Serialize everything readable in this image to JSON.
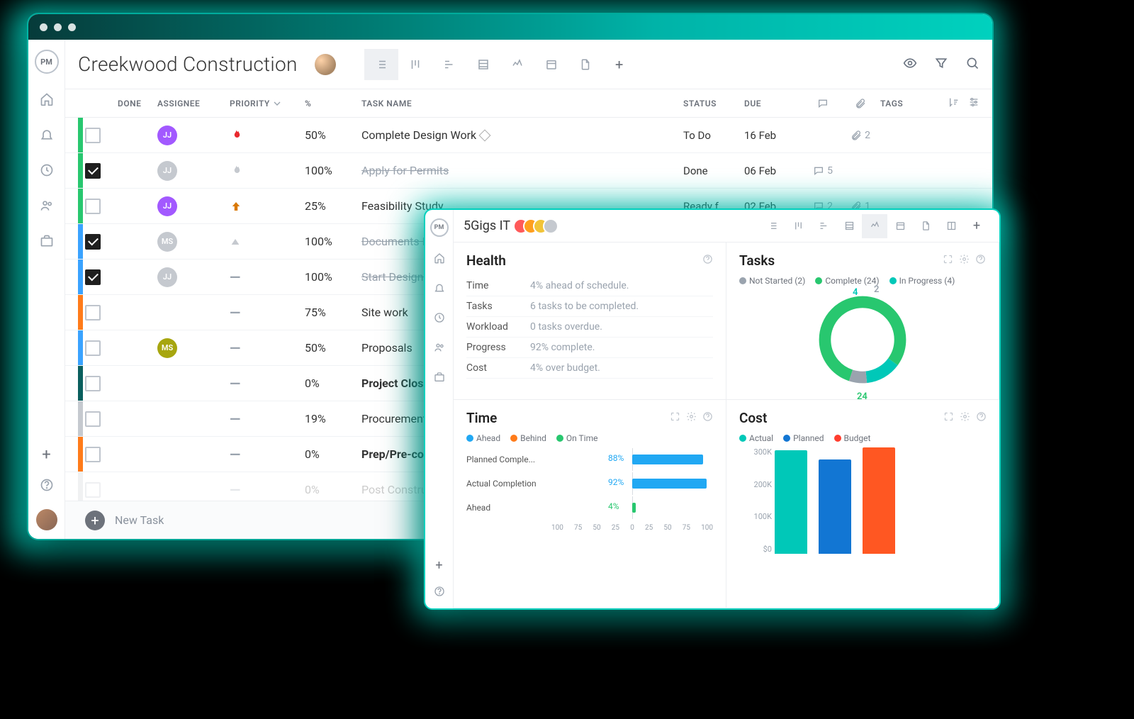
{
  "main": {
    "project_title": "Creekwood Construction",
    "columns": {
      "done": "DONE",
      "assignee": "ASSIGNEE",
      "priority": "PRIORITY",
      "pct": "%",
      "task_name": "TASK NAME",
      "status": "STATUS",
      "due": "DUE",
      "tags": "TAGS"
    },
    "tasks": [
      {
        "color": "cb-green",
        "done": false,
        "assignee": "JJ",
        "assignee_cls": "as-purple",
        "priority": "flame",
        "pct": "50%",
        "name": "Complete Design Work",
        "diamond": true,
        "status": "To Do",
        "due": "16 Feb",
        "attach": "2"
      },
      {
        "color": "cb-green",
        "done": true,
        "assignee": "JJ",
        "assignee_cls": "as-gray",
        "priority": "flame-g",
        "pct": "100%",
        "name": "Apply for Permits",
        "strike": true,
        "status": "Done",
        "due": "06 Feb",
        "comments": "5"
      },
      {
        "color": "cb-green",
        "done": false,
        "assignee": "JJ",
        "assignee_cls": "as-purple",
        "priority": "up",
        "pct": "25%",
        "name": "Feasibility Study",
        "status": "Ready f..",
        "due": "02 Feb",
        "comments": "2",
        "attach": "1"
      },
      {
        "color": "cb-blue",
        "done": true,
        "assignee": "MS",
        "assignee_cls": "as-gray",
        "priority": "tri-g",
        "pct": "100%",
        "name": "Documents Review",
        "strike": true
      },
      {
        "color": "cb-blue",
        "done": true,
        "assignee": "JJ",
        "assignee_cls": "as-gray",
        "priority": "eq",
        "pct": "100%",
        "name": "Start Design Work",
        "strike": true
      },
      {
        "color": "cb-orange",
        "done": false,
        "assignee": "",
        "assignee_cls": "",
        "priority": "eq",
        "pct": "75%",
        "name": "Site work"
      },
      {
        "color": "cb-blue",
        "done": false,
        "assignee": "MS",
        "assignee_cls": "as-olive",
        "priority": "eq",
        "pct": "50%",
        "name": "Proposals"
      },
      {
        "color": "cb-teal",
        "done": false,
        "assignee": "",
        "assignee_cls": "",
        "priority": "eq",
        "pct": "0%",
        "name": "Project Closing Phase",
        "bold": true
      },
      {
        "color": "cb-gray",
        "done": false,
        "assignee": "",
        "assignee_cls": "",
        "priority": "eq",
        "pct": "19%",
        "name": "Procurement"
      },
      {
        "color": "cb-orange",
        "done": false,
        "assignee": "",
        "assignee_cls": "",
        "priority": "eq",
        "pct": "0%",
        "name": "Prep/Pre-construction",
        "bold": true
      },
      {
        "color": "cb-gray",
        "done": false,
        "assignee": "",
        "assignee_cls": "",
        "priority": "eq",
        "pct": "0%",
        "name": "Post Construction",
        "faded": true
      }
    ],
    "new_task": "New Task"
  },
  "overlay": {
    "project_title": "5Gigs IT",
    "panels": {
      "health_title": "Health",
      "tasks_title": "Tasks",
      "time_title": "Time",
      "cost_title": "Cost"
    },
    "health": [
      {
        "k": "Time",
        "v": "4% ahead of schedule."
      },
      {
        "k": "Tasks",
        "v": "6 tasks to be completed."
      },
      {
        "k": "Workload",
        "v": "0 tasks overdue."
      },
      {
        "k": "Progress",
        "v": "92% complete."
      },
      {
        "k": "Cost",
        "v": "4% over budget."
      }
    ],
    "tasks_legend": [
      {
        "dot": "d-gray",
        "label": "Not Started (2)"
      },
      {
        "dot": "d-green",
        "label": "Complete (24)"
      },
      {
        "dot": "d-teal",
        "label": "In Progress (4)"
      }
    ],
    "time_legend": [
      {
        "dot": "d-blueA",
        "label": "Ahead"
      },
      {
        "dot": "d-orange",
        "label": "Behind"
      },
      {
        "dot": "d-green",
        "label": "On Time"
      }
    ],
    "cost_legend": [
      {
        "dot": "d-teal",
        "label": "Actual"
      },
      {
        "dot": "d-blueP",
        "label": "Planned"
      },
      {
        "dot": "d-red",
        "label": "Budget"
      }
    ],
    "time_rows": [
      {
        "label": "Planned Comple...",
        "value": "88%",
        "color": "#21a8f3"
      },
      {
        "label": "Actual Completion",
        "value": "92%",
        "color": "#21a8f3"
      },
      {
        "label": "Ahead",
        "value": "4%",
        "color": "#28c76f"
      }
    ],
    "time_axis": [
      "100",
      "75",
      "50",
      "25",
      "0",
      "25",
      "50",
      "75",
      "100"
    ],
    "cost_yaxis": [
      "300K",
      "200K",
      "100K",
      "$0"
    ]
  },
  "chart_data": [
    {
      "type": "pie",
      "title": "Tasks",
      "series": [
        {
          "name": "Not Started",
          "value": 2,
          "color": "#9aa3ae"
        },
        {
          "name": "Complete",
          "value": 24,
          "color": "#28c76f"
        },
        {
          "name": "In Progress",
          "value": 4,
          "color": "#00c8b8"
        }
      ]
    },
    {
      "type": "bar",
      "title": "Time",
      "orientation": "diverging-horizontal",
      "xrange": [
        -100,
        100
      ],
      "categories": [
        "Planned Completion",
        "Actual Completion",
        "Ahead"
      ],
      "values": [
        88,
        92,
        4
      ],
      "colors": [
        "#21a8f3",
        "#21a8f3",
        "#28c76f"
      ],
      "legend": [
        "Ahead",
        "Behind",
        "On Time"
      ]
    },
    {
      "type": "bar",
      "title": "Cost",
      "ylabel": "",
      "ylim": [
        0,
        350000
      ],
      "yticks": [
        0,
        100000,
        200000,
        300000
      ],
      "categories": [
        "Actual",
        "Planned",
        "Budget"
      ],
      "values": [
        340000,
        310000,
        350000
      ],
      "colors": [
        "#00c8b8",
        "#1276d3",
        "#ff5722"
      ]
    }
  ]
}
